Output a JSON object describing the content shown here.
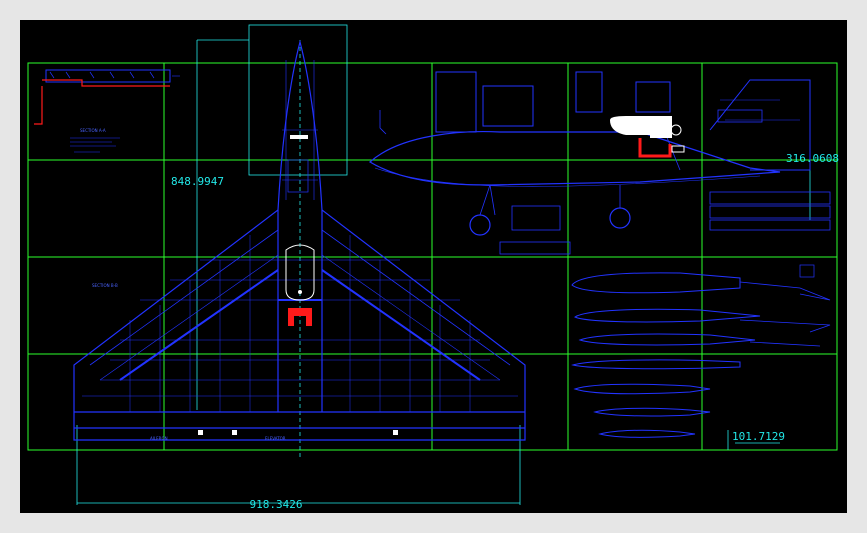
{
  "colors": {
    "background": "#000000",
    "frame": "#e6e6e6",
    "grid": "#2cff2c",
    "drawing": "#2233ff",
    "dimension": "#22e8e8",
    "highlight": "#ff1a1a",
    "white": "#ffffff"
  },
  "dimensions": {
    "wing_height": "848.9947",
    "total_span": "918.3426",
    "tail_height": "316.0608",
    "detail_size": "101.7129"
  },
  "labels": {
    "section_a": "SECTION A-A",
    "section_b": "SECTION B-B",
    "aileron": "AILERON",
    "elevator": "ELEVATOR"
  }
}
